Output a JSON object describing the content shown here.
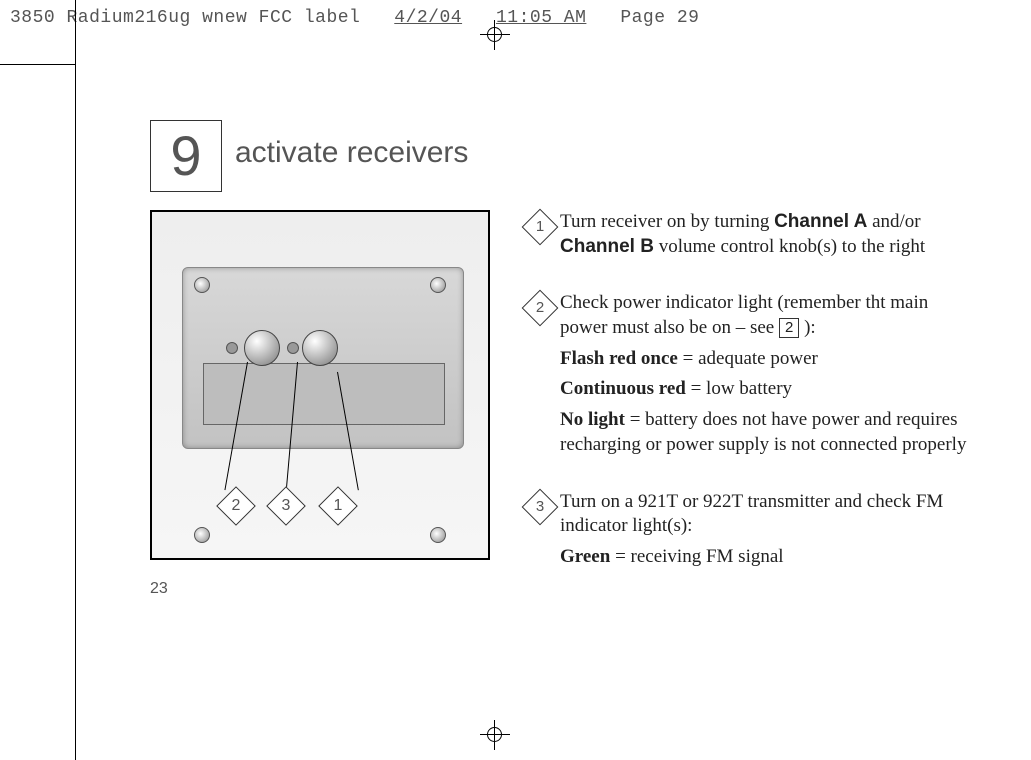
{
  "print_header": {
    "filename": "3850 Radium216ug wnew FCC label",
    "date": "4/2/04",
    "time": "11:05 AM",
    "page_label": "Page 29"
  },
  "section": {
    "number": "9",
    "title": "activate receivers"
  },
  "figure": {
    "callouts": [
      "2",
      "3",
      "1"
    ]
  },
  "page_number": "23",
  "steps": [
    {
      "marker": "1",
      "paragraphs": [
        {
          "runs": [
            {
              "t": "Turn receiver on by turning "
            },
            {
              "t": "Channel A",
              "style": "sansbold"
            },
            {
              "t": " and/or "
            },
            {
              "t": "Channel B",
              "style": "sansbold"
            },
            {
              "t": " volume control knob(s) to the right"
            }
          ]
        }
      ]
    },
    {
      "marker": "2",
      "paragraphs": [
        {
          "runs": [
            {
              "t": "Check power indicator light (remember tht main power must also be on – see "
            },
            {
              "t": "2",
              "style": "box"
            },
            {
              "t": " ):"
            }
          ]
        },
        {
          "runs": [
            {
              "t": "Flash red once",
              "style": "bold"
            },
            {
              "t": " = adequate power"
            }
          ]
        },
        {
          "runs": [
            {
              "t": "Continuous red",
              "style": "bold"
            },
            {
              "t": " = low battery"
            }
          ]
        },
        {
          "runs": [
            {
              "t": "No light",
              "style": "bold"
            },
            {
              "t": " = battery does not have power and requires recharging or power supply is not connected properly"
            }
          ]
        }
      ]
    },
    {
      "marker": "3",
      "paragraphs": [
        {
          "runs": [
            {
              "t": "Turn on a 921T or 922T transmitter and check FM indicator light(s):"
            }
          ]
        },
        {
          "runs": [
            {
              "t": "Green",
              "style": "bold"
            },
            {
              "t": " = receiving FM signal"
            }
          ]
        }
      ]
    }
  ]
}
